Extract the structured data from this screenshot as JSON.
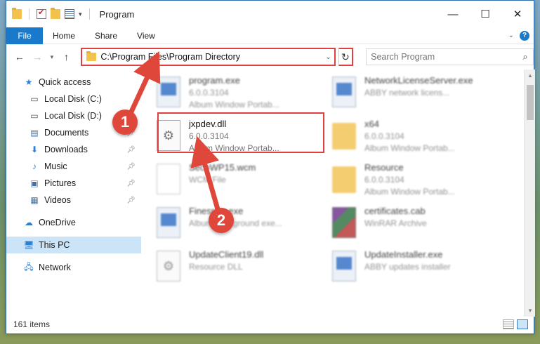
{
  "window": {
    "title": "Program",
    "controls": {
      "minimize": "—",
      "maximize": "☐",
      "close": "✕"
    }
  },
  "ribbon": {
    "tabs": [
      "File",
      "Home",
      "Share",
      "View"
    ],
    "help": "?"
  },
  "nav": {
    "address": "C:\\Program Files\\Program Directory",
    "search_placeholder": "Search Program"
  },
  "sidebar": {
    "items": [
      {
        "label": "Quick access",
        "icon": "star-icon"
      },
      {
        "label": "Local Disk (C:)",
        "icon": "drive-icon"
      },
      {
        "label": "Local Disk (D:)",
        "icon": "drive-icon"
      },
      {
        "label": "Documents",
        "icon": "documents-icon",
        "pinned": true
      },
      {
        "label": "Downloads",
        "icon": "download-icon",
        "pinned": true
      },
      {
        "label": "Music",
        "icon": "music-icon",
        "pinned": true
      },
      {
        "label": "Pictures",
        "icon": "pictures-icon",
        "pinned": true
      },
      {
        "label": "Videos",
        "icon": "videos-icon",
        "pinned": true
      },
      {
        "label": "OneDrive",
        "icon": "cloud-icon"
      },
      {
        "label": "This PC",
        "icon": "computer-icon",
        "selected": true
      },
      {
        "label": "Network",
        "icon": "network-icon"
      }
    ]
  },
  "files": [
    {
      "name": "program.exe",
      "version": "6.0.0.3104",
      "desc": "Album Window Portab...",
      "type": "exe"
    },
    {
      "name": "NetworkLicenseServer.exe",
      "version": "",
      "desc": "ABBY network licens...",
      "type": "exe"
    },
    {
      "name": "jxpdev.dll",
      "version": "6.0.0.3104",
      "desc": "Album Window Portab...",
      "type": "dll"
    },
    {
      "name": "x64",
      "version": "6.0.0.3104",
      "desc": "Album Window Portab...",
      "type": "folder"
    },
    {
      "name": "SecoWP15.wcm",
      "version": "",
      "desc": "WCM File",
      "type": "doc"
    },
    {
      "name": "Resource",
      "version": "6.0.0.3104",
      "desc": "Album Window Portab...",
      "type": "folder"
    },
    {
      "name": "Finespec.exe",
      "version": "",
      "desc": "Album background exe...",
      "type": "exe"
    },
    {
      "name": "certificates.cab",
      "version": "",
      "desc": "WinRAR Archive",
      "type": "cab"
    },
    {
      "name": "UpdateClient19.dll",
      "version": "",
      "desc": "Resource DLL",
      "type": "dll"
    },
    {
      "name": "UpdateInstaller.exe",
      "version": "",
      "desc": "ABBY updates installer",
      "type": "exe"
    }
  ],
  "status": {
    "count": "161 items"
  },
  "callouts": {
    "step1": "1",
    "step2": "2"
  },
  "colors": {
    "accent": "#1979ca",
    "highlight": "#e04040"
  }
}
